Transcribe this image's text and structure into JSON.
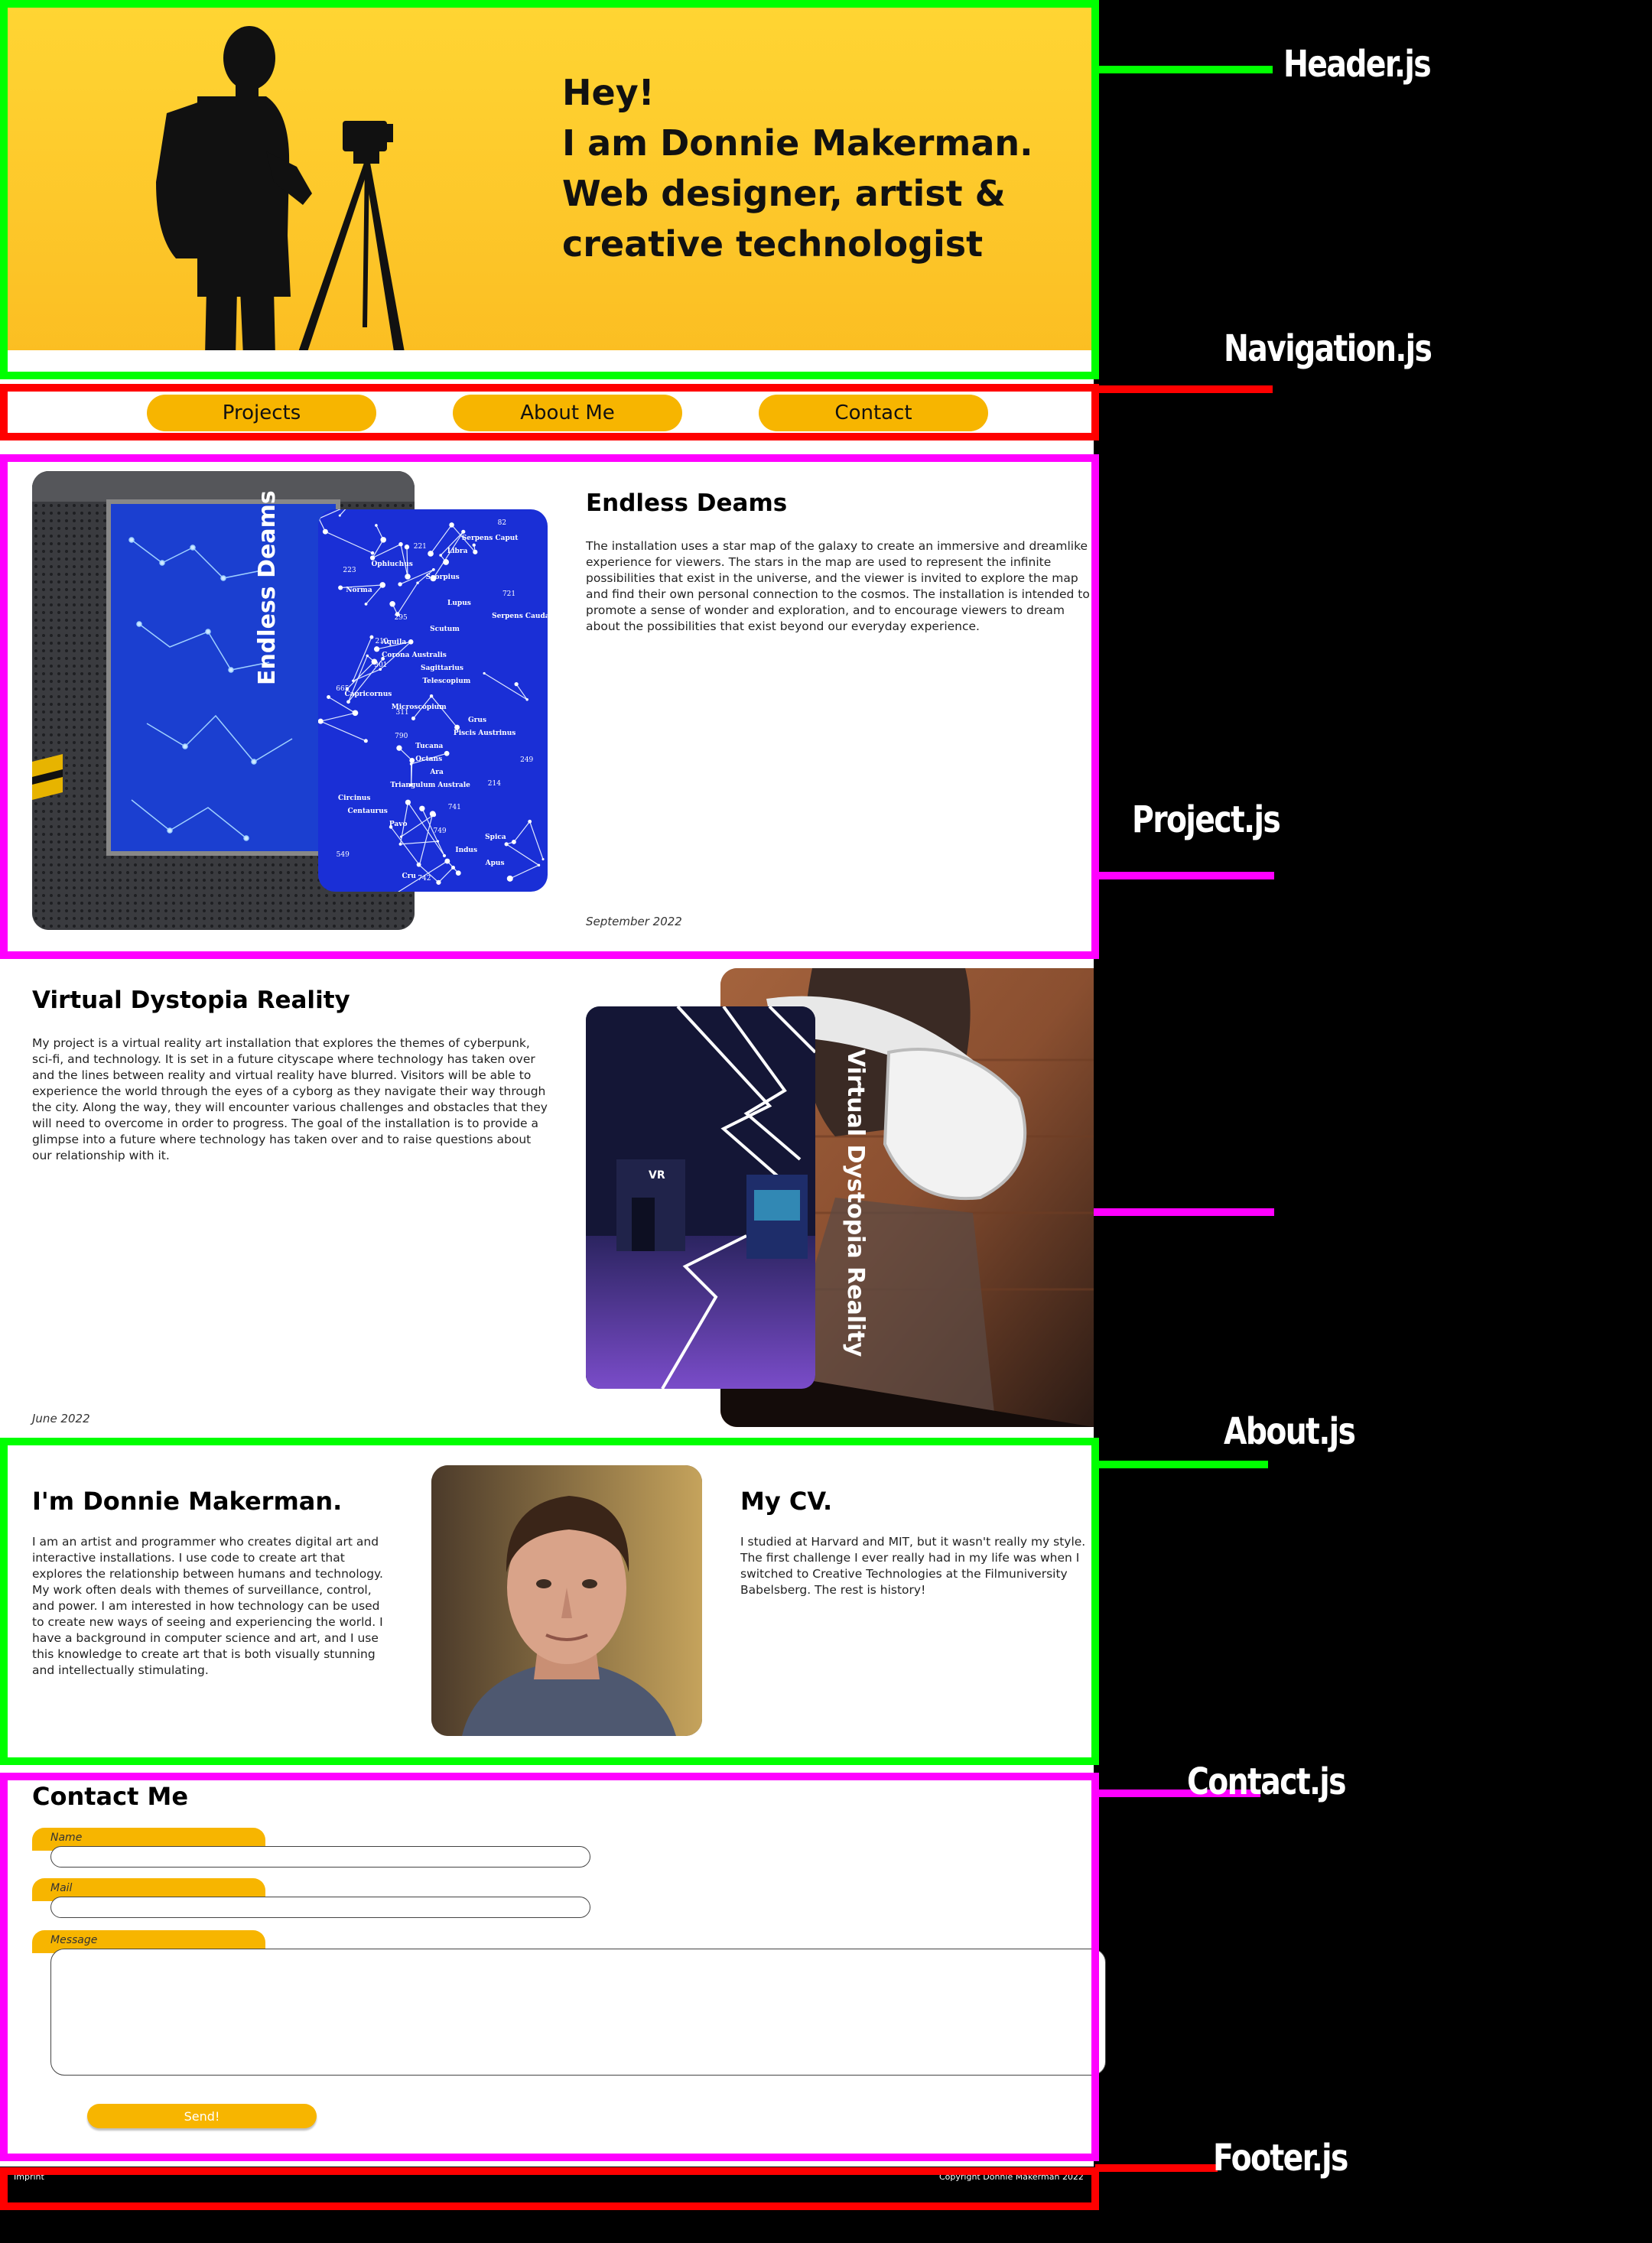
{
  "header": {
    "line1": "Hey!",
    "line2": "I am Donnie Makerman.",
    "line3": "Web designer, artist &",
    "line4": "creative technologist"
  },
  "nav": {
    "projects": "Projects",
    "about": "About Me",
    "contact": "Contact"
  },
  "projects": [
    {
      "title": "Endless Deams",
      "vertical_title": "Endless Deams",
      "description": "The installation uses a star map of the galaxy to create an immersive and dreamlike experience for viewers. The stars in the map are used to represent the infinite possibilities that exist in the universe, and the viewer is invited to explore the map and find their own personal connection to the cosmos. The installation is intended to promote a sense of wonder and exploration, and to encourage viewers to dream about the possibilities that exist beyond our everyday experience.",
      "date": "September 2022"
    },
    {
      "title": "Virtual Dystopia Reality",
      "vertical_title": "Virtual Dystopia Reality",
      "description": "My project is a virtual reality art installation that explores the themes of cyberpunk, sci-fi, and technology. It is set in a future cityscape where technology has taken over and the lines between reality and virtual reality have blurred. Visitors will be able to experience the world through the eyes of a cyborg as they navigate their way through the city. Along the way, they will encounter various challenges and obstacles that they will need to overcome in order to progress. The goal of the installation is to provide a glimpse into a future where technology has taken over and to raise questions about our relationship with it.",
      "date": "June 2022"
    }
  ],
  "about": {
    "title": "I'm Donnie Makerman.",
    "text": "I am an artist and programmer who creates digital art and interactive installations. I use code to create art that explores the relationship between humans and technology. My work often deals with themes of surveillance, control, and power. I am interested in how technology can be used to create new ways of seeing and experiencing the world. I have a background in computer science and art, and I use this knowledge to create art that is both visually stunning and intellectually stimulating.",
    "cv_title": "My CV.",
    "cv_text": "I studied at Harvard and MIT, but it wasn't really my style. The first challenge I ever really had in my life was when I switched to Creative Technologies at the Filmuniversity Babelsberg. The rest is history!"
  },
  "contact": {
    "title": "Contact Me",
    "name_label": "Name",
    "mail_label": "Mail",
    "message_label": "Message",
    "send_label": "Send!"
  },
  "footer": {
    "imprint": "Imprint",
    "copyright": "Copyright Donnie Makerman 2022"
  },
  "component_labels": {
    "header": "Header.js",
    "navigation": "Navigation.js",
    "project": "Project.js",
    "about": "About.js",
    "contact": "Contact.js",
    "footer": "Footer.js"
  },
  "star_labels": [
    "Serpens Caput",
    "Libra",
    "Ophiuchus",
    "Scorpius",
    "Norma",
    "Lupus",
    "Serpens Cauda",
    "Scutum",
    "Aquila",
    "Corona Australis",
    "Sagittarius",
    "Telescopium",
    "Capricornus",
    "Microscopium",
    "Grus",
    "Piscis Austrinus",
    "Tucana",
    "Octans",
    "Ara",
    "Triangulum Australe",
    "Circinus",
    "Centaurus",
    "Pavo",
    "Spica",
    "Indus",
    "Apus",
    "Cru"
  ],
  "star_numbers": [
    "82",
    "221",
    "223",
    "721",
    "295",
    "210",
    "301",
    "665",
    "311",
    "790",
    "249",
    "214",
    "741",
    "749",
    "549",
    "742"
  ],
  "vr_sign": "VR",
  "colors": {
    "accent_yellow": "#f7b500",
    "header_green": "#00ff00",
    "nav_red": "#ff0000",
    "project_magenta": "#ff00ff"
  }
}
